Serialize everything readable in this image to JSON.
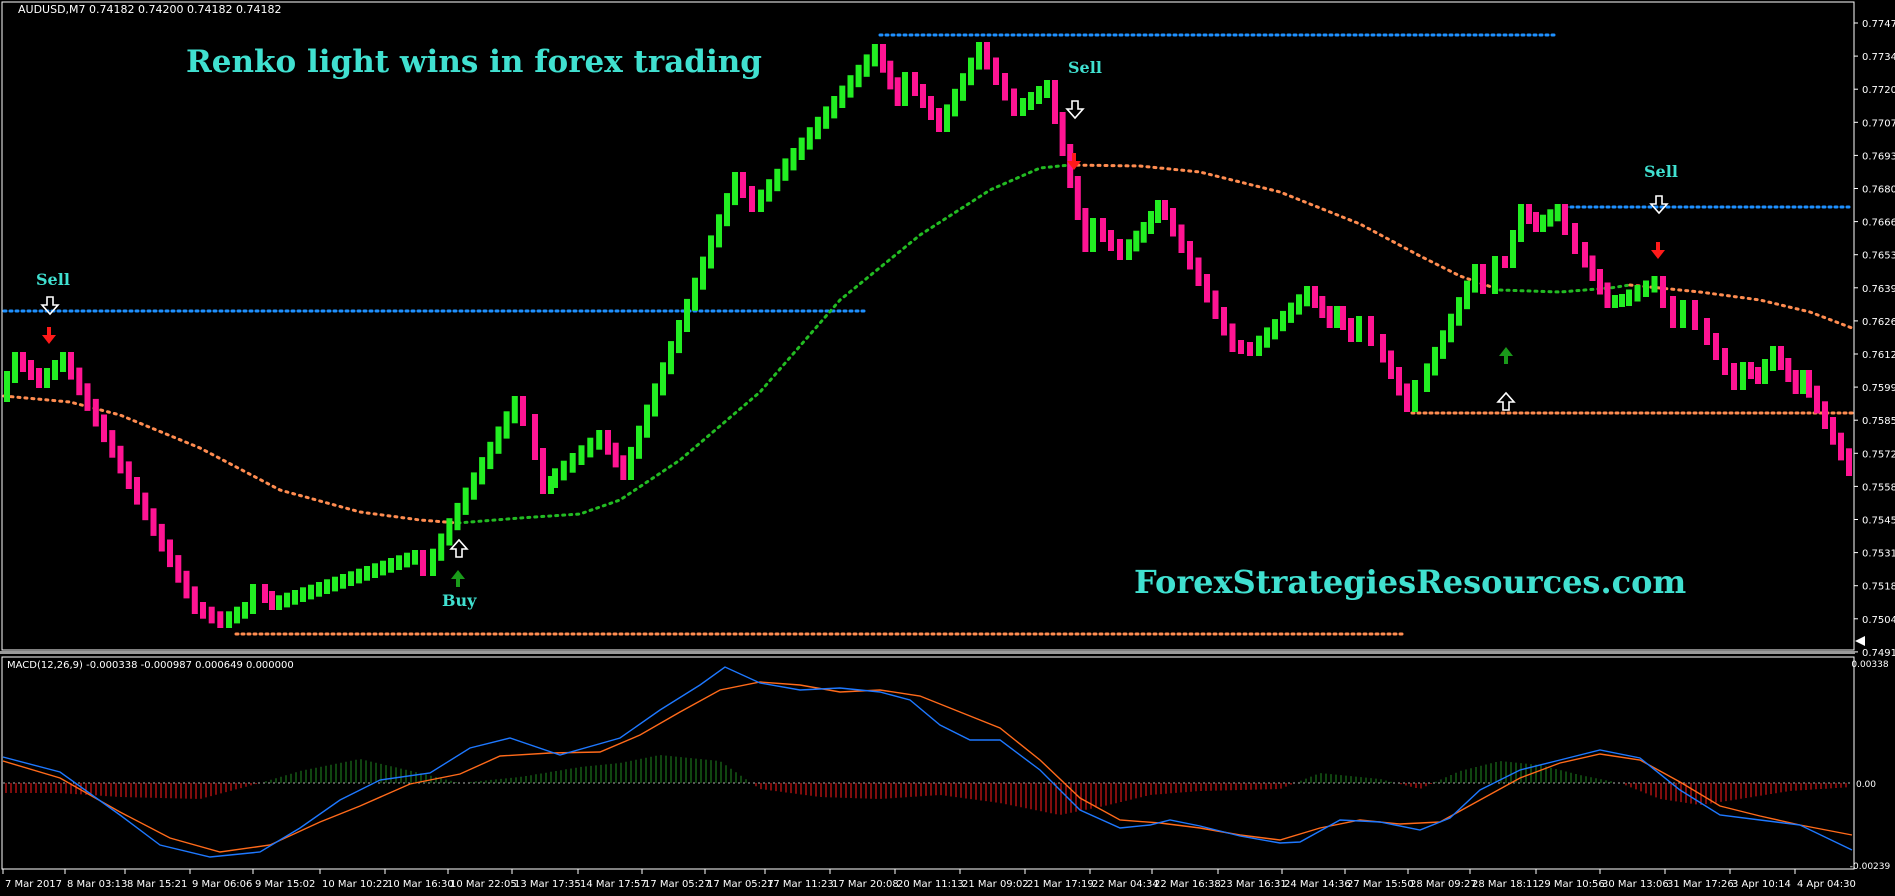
{
  "main_chart": {
    "symbol_info": "AUDUSD,M7  0.74182 0.74200 0.74182 0.74182",
    "title": "Renko light wins in  forex trading",
    "watermark": "ForexStrategiesResources.com",
    "colors": {
      "up_brick": "#22ee22",
      "down_brick": "#ff1493",
      "level_blue": "#1e90ff",
      "level_orange": "#ff8c50",
      "ma_green": "#22bb22",
      "ma_orange": "#ff8c50",
      "signal_text": "#40e0d0",
      "arrow_red": "#ff1a1a",
      "arrow_green": "#1a9a1a"
    },
    "price_axis": [
      "0.77475",
      "0.77340",
      "0.77205",
      "0.77070",
      "0.76935",
      "0.76800",
      "0.76665",
      "0.76530",
      "0.76395",
      "0.76260",
      "0.76125",
      "0.75990",
      "0.75855",
      "0.75720",
      "0.75585",
      "0.75450",
      "0.75315",
      "0.75180",
      "0.75045",
      "0.74910"
    ],
    "signals": [
      {
        "label": "Sell"
      },
      {
        "label": "Buy"
      },
      {
        "label": "Sell"
      },
      {
        "label": "Sell"
      }
    ]
  },
  "macd": {
    "header": "MACD(12,26,9) -0.000338 -0.000987 0.000649 0.000000",
    "axis": [
      "0.00338",
      "0.00",
      "-0.00239"
    ],
    "colors": {
      "macd_line": "#1e78ff",
      "signal_line": "#ff6a1a",
      "hist_pos": "#1f8a1f",
      "hist_neg": "#ff1a1a"
    }
  },
  "time_axis": [
    "7 Mar 2017",
    "8 Mar 03:13",
    "8 Mar 15:21",
    "9 Mar 06:06",
    "9 Mar 15:02",
    "10 Mar 10:22",
    "10 Mar 16:30",
    "10 Mar 22:05",
    "13 Mar 17:35",
    "14 Mar 17:57",
    "17 Mar 05:27",
    "17 Mar 05:27",
    "17 Mar 11:23",
    "17 Mar 20:08",
    "20 Mar 11:13",
    "21 Mar 09:02",
    "21 Mar 17:19",
    "22 Mar 04:34",
    "22 Mar 16:38",
    "23 Mar 16:31",
    "24 Mar 14:36",
    "27 Mar 15:50",
    "28 Mar 09:27",
    "28 Mar 18:11",
    "29 Mar 10:56",
    "30 Mar 13:06",
    "31 Mar 17:26",
    "3 Apr 10:14",
    "4 Apr 04:30"
  ]
}
